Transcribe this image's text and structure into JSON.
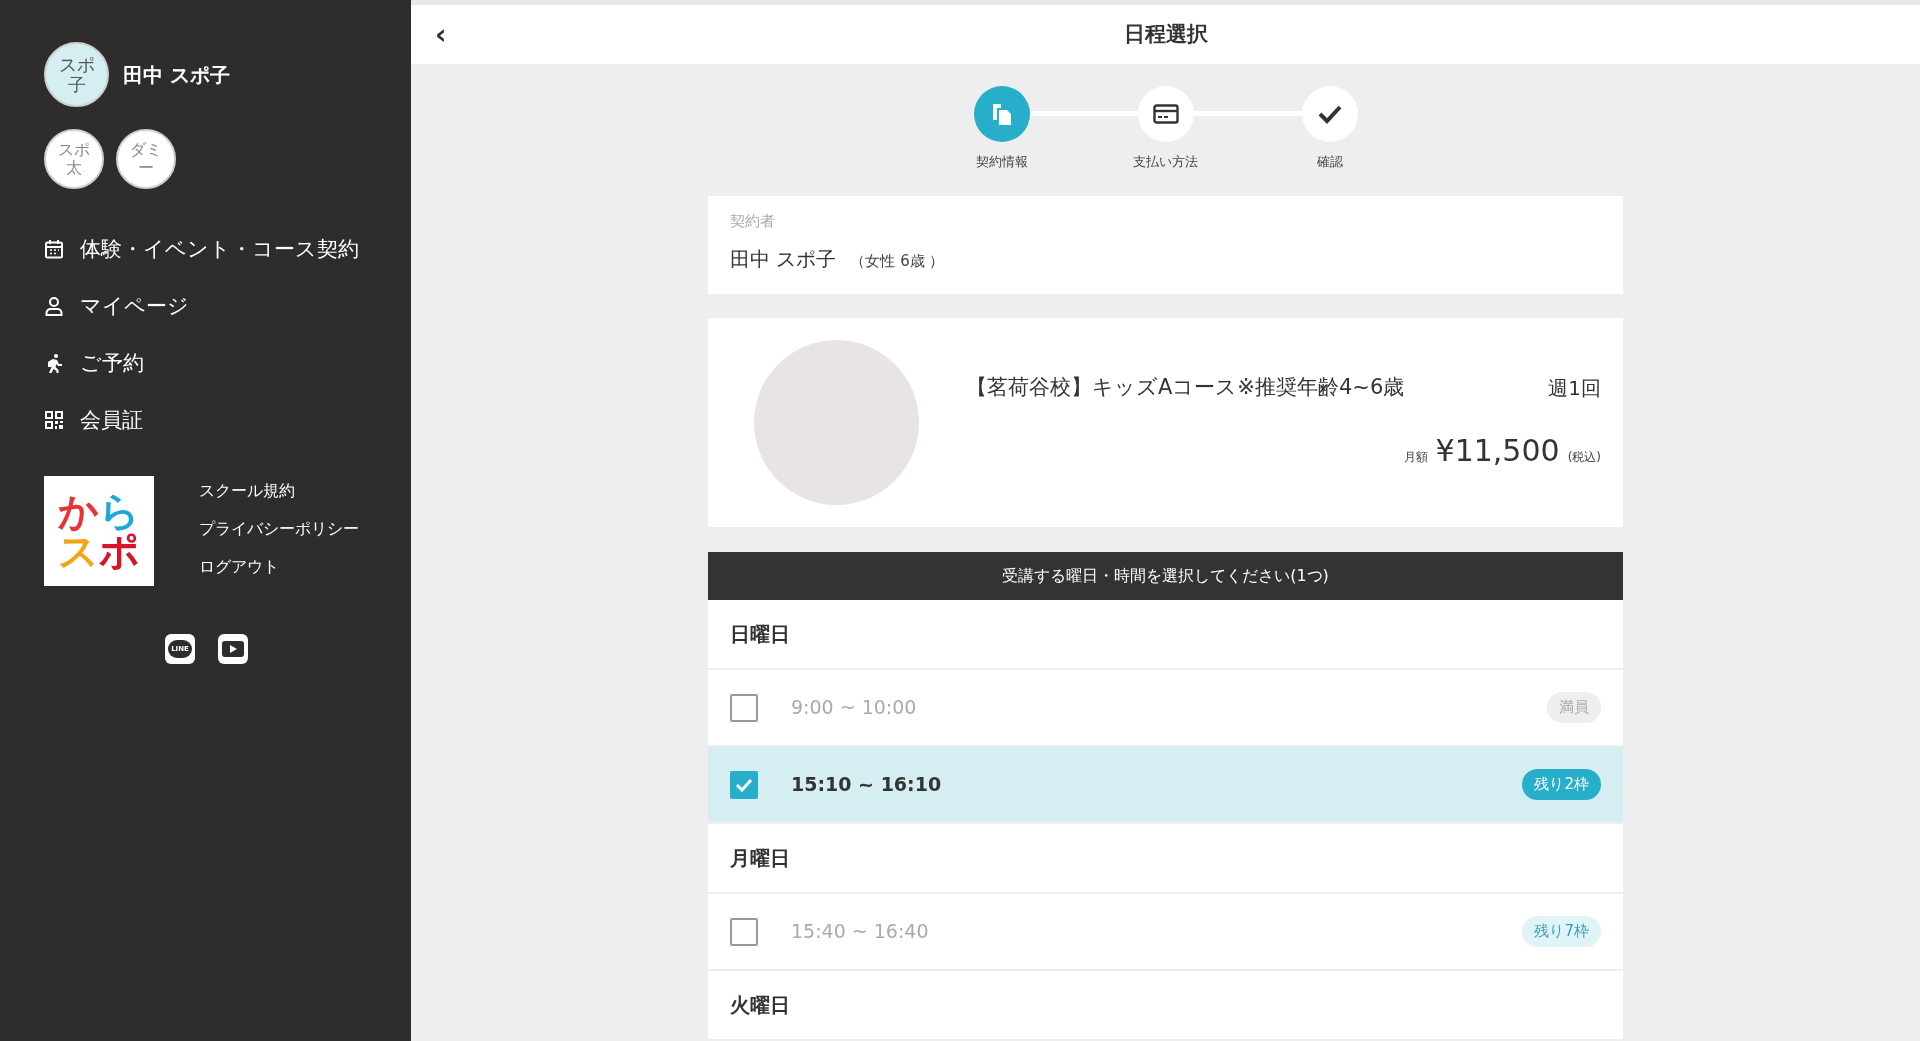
{
  "sidebar": {
    "user": {
      "avatar": "スポ子",
      "name": "田中 スポ子"
    },
    "avatars": [
      {
        "label": "スポ太",
        "selected": false
      },
      {
        "label": "ダミー",
        "selected": false
      }
    ],
    "menu": [
      {
        "kind": "calendar",
        "label": "体験・イベント・コース契約"
      },
      {
        "kind": "user",
        "label": "マイページ"
      },
      {
        "kind": "run",
        "label": "ご予約"
      },
      {
        "kind": "qr",
        "label": "会員証"
      }
    ],
    "logo": {
      "line1": [
        "か",
        "ら"
      ],
      "line2": [
        "ス",
        "ポ"
      ]
    },
    "links": [
      "スクール規約",
      "プライバシーポリシー",
      "ログアウト"
    ],
    "social": [
      {
        "kind": "line",
        "label": "LINE"
      },
      {
        "kind": "youtube"
      }
    ]
  },
  "header": {
    "back": "‹",
    "title": "日程選択"
  },
  "steps": [
    {
      "kind": "docs",
      "label": "契約情報",
      "selected": true
    },
    {
      "kind": "card",
      "label": "支払い方法",
      "selected": false
    },
    {
      "kind": "check",
      "label": "確認",
      "selected": false
    }
  ],
  "contractor": {
    "label": "契約者",
    "name": "田中 スポ子",
    "detail": "（女性 6歳 ）"
  },
  "course": {
    "title": "【茗荷谷校】キッズAコース※推奨年齢4~6歳",
    "frequency": "週1回",
    "price_label": "月額",
    "price": "¥11,500",
    "tax": "(税込)"
  },
  "schedule": {
    "heading": "受講する曜日・時間を選択してください(1つ)",
    "days": [
      {
        "name": "日曜日",
        "slots": [
          {
            "time": "9:00 ~ 10:00",
            "selected": false,
            "disabled": true,
            "badge": "満員",
            "kind": "full"
          },
          {
            "time": "15:10 ~ 16:10",
            "selected": true,
            "disabled": false,
            "badge": "残り2枠",
            "kind": "remaining"
          }
        ]
      },
      {
        "name": "月曜日",
        "slots": [
          {
            "time": "15:40 ~ 16:40",
            "selected": false,
            "disabled": true,
            "badge": "残り7枠",
            "kind": "remaining"
          }
        ]
      },
      {
        "name": "火曜日"
      }
    ]
  }
}
